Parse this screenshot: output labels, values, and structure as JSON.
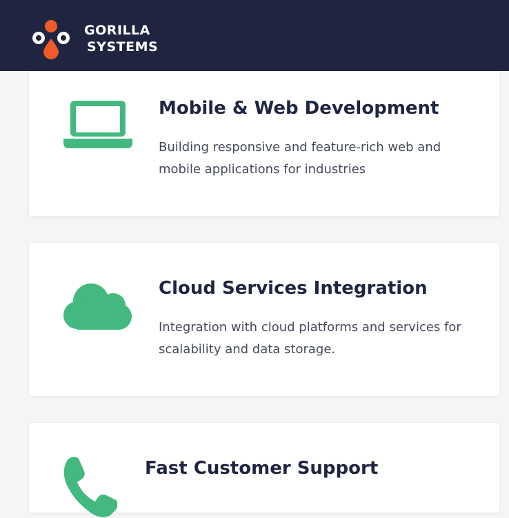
{
  "brand": {
    "line1": "GORILLA",
    "line2": "SYSTEMS",
    "colors": {
      "header_bg": "#1f2541",
      "accent_orange": "#f05a28",
      "accent_green": "#43b97f"
    }
  },
  "services": [
    {
      "icon": "laptop-icon",
      "title": "Mobile & Web Development",
      "description": "Building responsive and feature-rich web and mobile applications for industries"
    },
    {
      "icon": "cloud-icon",
      "title": "Cloud Services Integration",
      "description": "Integration with cloud platforms and services for scalability and data storage."
    },
    {
      "icon": "phone-icon",
      "title": "Fast Customer Support"
    }
  ]
}
